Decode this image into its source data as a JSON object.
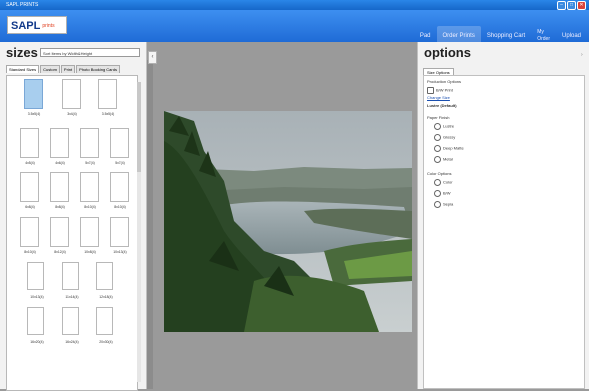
{
  "window": {
    "title": "SAPL PRINTS",
    "controls": [
      "–",
      "□",
      "✕"
    ]
  },
  "brand": {
    "logo_main": "SAPL",
    "logo_sub": "prints"
  },
  "nav": {
    "links": [
      {
        "label": "Pad",
        "active": false
      },
      {
        "label": "Order Prints",
        "active": true
      },
      {
        "label": "Shopping Cart",
        "active": false
      },
      {
        "label": "My\nOrder",
        "active": false
      },
      {
        "label": "Upload",
        "active": false
      }
    ]
  },
  "left_panel": {
    "title": "sizes",
    "search_value": "Sort Items by Width&Height",
    "tabs": [
      "Standard Sizes",
      "Custom",
      "Print",
      "Photo Booking Cards"
    ],
    "rows": [
      {
        "sizes": [
          "3.5x5(4)",
          "3x4(4)",
          "3.5x5(4)"
        ],
        "count": 3
      },
      {
        "sizes": [
          "4x5(4)",
          "4x6(4)",
          "5x7(4)",
          "5x7(4)"
        ],
        "count": 4
      },
      {
        "sizes": [
          "6x8(4)",
          "8x8(4)",
          "8x10(4)",
          "8x10(4)"
        ],
        "count": 4
      },
      {
        "sizes": [
          "8x10(4)",
          "8x12(4)",
          "10x8(4)",
          "10x13(4)"
        ],
        "count": 4
      },
      {
        "sizes": [
          "10x13(4)",
          "11x14(4)",
          "12x18(4)"
        ],
        "count": 3
      },
      {
        "sizes": [
          "16x20(4)",
          "16x24(4)",
          "20x30(4)"
        ],
        "count": 3
      }
    ]
  },
  "right_panel": {
    "title": "options",
    "tab": "Size Options",
    "items": [
      {
        "type": "heading",
        "text": "Production Options"
      },
      {
        "type": "check",
        "text": "B/W Print"
      },
      {
        "type": "link",
        "text": "Change Size"
      },
      {
        "type": "bold",
        "text": "Lustre (Default)"
      },
      {
        "type": "heading",
        "text": "Paper Finish"
      },
      {
        "type": "radio",
        "text": "Lustre"
      },
      {
        "type": "radio",
        "text": "Glossy"
      },
      {
        "type": "radio",
        "text": "Deep Matte"
      },
      {
        "type": "radio",
        "text": "Metal"
      },
      {
        "type": "heading",
        "text": "Color Options"
      },
      {
        "type": "radio",
        "text": "Color"
      },
      {
        "type": "radio",
        "text": "B/W"
      },
      {
        "type": "radio",
        "text": "Sepia"
      }
    ]
  },
  "colors": {
    "titlebar": "#1667c9",
    "nav": "#2a7be0",
    "selected_tile": "#a8ceee"
  }
}
